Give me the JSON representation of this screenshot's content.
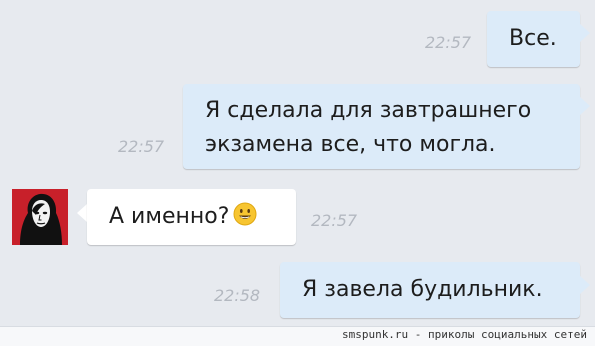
{
  "messages": [
    {
      "direction": "out",
      "time": "22:57",
      "lines": [
        "Все."
      ]
    },
    {
      "direction": "out",
      "time": "22:57",
      "lines": [
        "Я сделала для завтрашнего",
        "экзамена все, что могла."
      ]
    },
    {
      "direction": "in",
      "time": "22:57",
      "lines": [
        "А именно?"
      ],
      "emoji": "smiling-face-icon"
    },
    {
      "direction": "out",
      "time": "22:58",
      "lines": [
        "Я завела будильник."
      ]
    }
  ],
  "footer": {
    "watermark": "smspunk.ru - приколы социальных сетей"
  },
  "colors": {
    "background": "#e7eaef",
    "outgoing_bubble": "#dcebf9",
    "incoming_bubble": "#ffffff",
    "timestamp": "#b3b8c0",
    "avatar_background": "#c8202a"
  }
}
